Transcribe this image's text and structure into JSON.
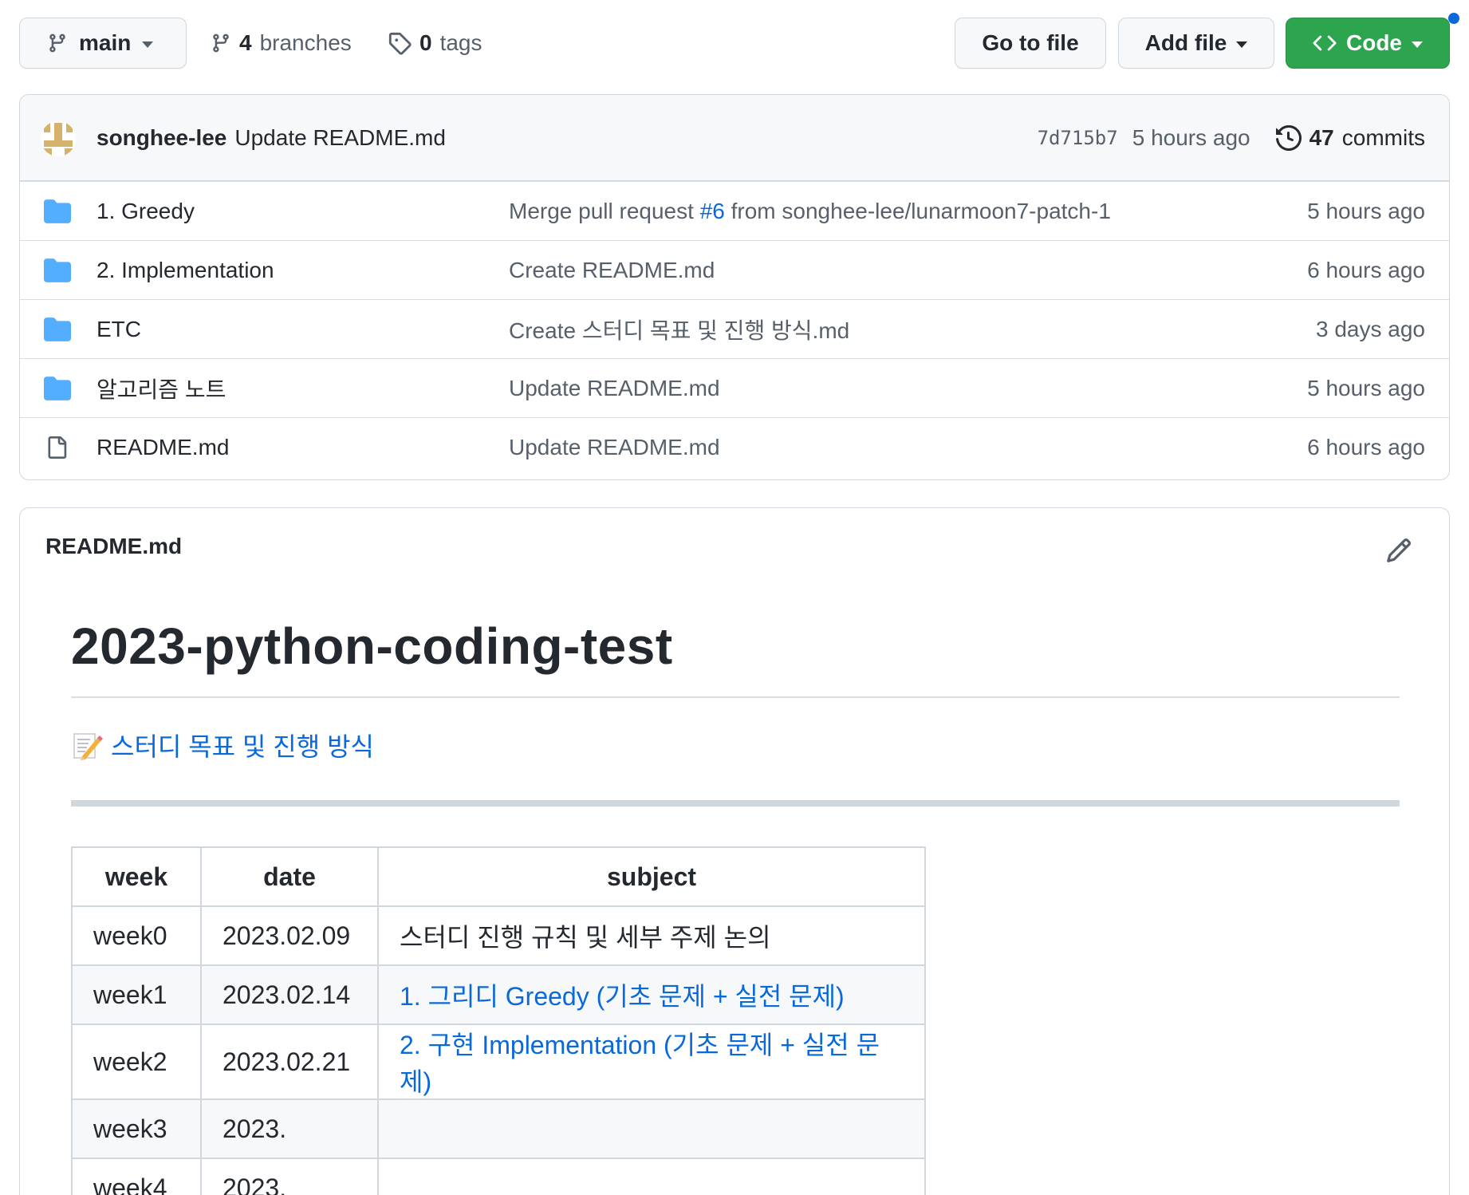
{
  "toolbar": {
    "branch_name": "main",
    "branches_count": "4",
    "branches_label": "branches",
    "tags_count": "0",
    "tags_label": "tags",
    "go_to_file_label": "Go to file",
    "add_file_label": "Add file",
    "code_label": "Code",
    "code_button_color": "#2da44e"
  },
  "latest_commit": {
    "author": "songhee-lee",
    "message": "Update README.md",
    "sha": "7d715b7",
    "age": "5 hours ago",
    "commits_count": "47",
    "commits_label": "commits"
  },
  "files": [
    {
      "type": "folder",
      "name": "1. Greedy",
      "msg_prefix": "Merge pull request ",
      "pr": "#6",
      "msg_suffix": " from songhee-lee/lunarmoon7-patch-1",
      "age": "5 hours ago"
    },
    {
      "type": "folder",
      "name": "2. Implementation",
      "message": "Create README.md",
      "age": "6 hours ago"
    },
    {
      "type": "folder",
      "name": "ETC",
      "message": "Create 스터디 목표 및 진행 방식.md",
      "age": "3 days ago"
    },
    {
      "type": "folder",
      "name": "알고리즘 노트",
      "message": "Update README.md",
      "age": "5 hours ago"
    },
    {
      "type": "file",
      "name": "README.md",
      "message": "Update README.md",
      "age": "6 hours ago"
    }
  ],
  "readme": {
    "header": "README.md",
    "title": "2023-python-coding-test",
    "study_link": "스터디 목표 및 진행 방식",
    "table": {
      "headers": [
        "week",
        "date",
        "subject"
      ],
      "rows": [
        {
          "week": "week0",
          "date": "2023.02.09",
          "subject": "스터디 진행 규칙 및 세부 주제 논의",
          "link": false
        },
        {
          "week": "week1",
          "date": "2023.02.14",
          "subject": "1. 그리디 Greedy (기초 문제 + 실전 문제)",
          "link": true
        },
        {
          "week": "week2",
          "date": "2023.02.21",
          "subject": "2. 구현 Implementation (기초 문제 + 실전 문제)",
          "link": true
        },
        {
          "week": "week3",
          "date": "2023.",
          "subject": "",
          "link": false
        },
        {
          "week": "week4",
          "date": "2023.",
          "subject": "",
          "link": false
        }
      ]
    }
  },
  "colors": {
    "link": "#0969da",
    "folder": "#54aeff",
    "border": "#d0d7de"
  }
}
